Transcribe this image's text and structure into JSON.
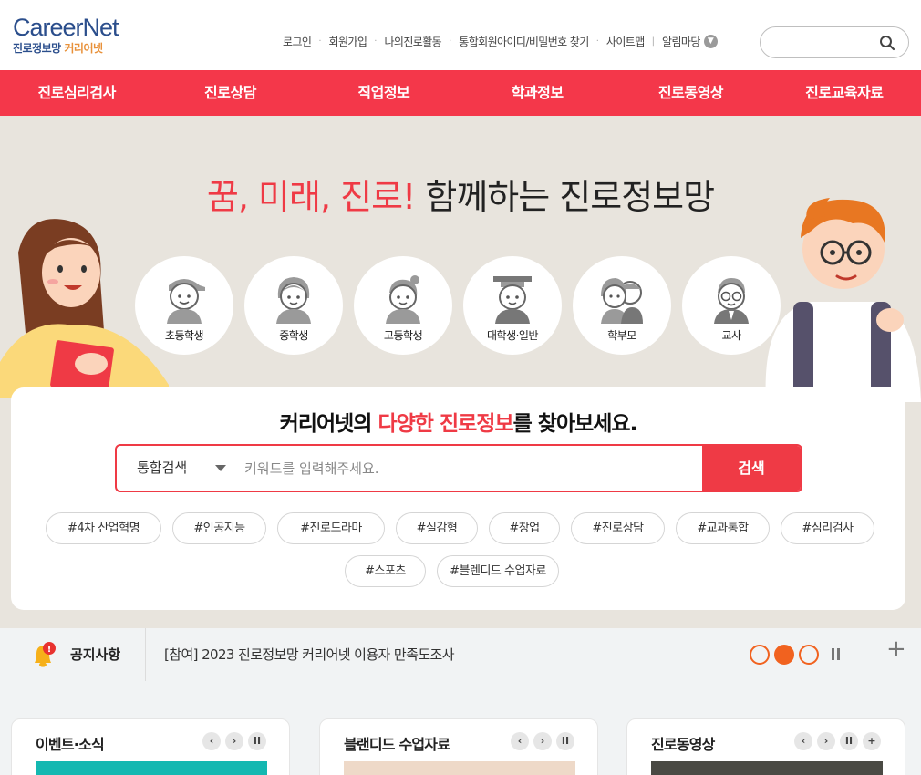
{
  "logo": {
    "main_a": "Career",
    "main_b": "Net",
    "sub_a": "진로정보망",
    "sub_b": "커리어넷"
  },
  "util": [
    "로그인",
    "회원가입",
    "나의진로활동",
    "통합회원아이디/비밀번호 찾기",
    "사이트맵",
    "알림마당"
  ],
  "nav": [
    "진로심리검사",
    "진로상담",
    "직업정보",
    "학과정보",
    "진로동영상",
    "진로교육자료"
  ],
  "hero": {
    "title_red": "꿈, 미래, 진로!",
    "title_rest": "함께하는 진로정보망",
    "targets": [
      "초등학생",
      "중학생",
      "고등학생",
      "대학생·일반",
      "학부모",
      "교사"
    ]
  },
  "search": {
    "title_a": "커리어넷의",
    "title_red": "다양한 진로정보",
    "title_b": "를 찾아보세요.",
    "select": "통합검색",
    "placeholder": "키워드를 입력해주세요.",
    "button": "검색",
    "tags_row1": [
      "#4차 산업혁명",
      "#인공지능",
      "#진로드라마",
      "#실감형",
      "#창업",
      "#진로상담",
      "#교과통합",
      "#심리검사"
    ],
    "tags_row2": [
      "#스포츠",
      "#블렌디드 수업자료"
    ]
  },
  "notice": {
    "label": "공지사항",
    "text": "[참여] 2023 진로정보망 커리어넷 이용자 만족도조사",
    "badge": "!",
    "plus": "+",
    "active_slide": 2,
    "slide_count": 3
  },
  "panels": [
    {
      "title": "이벤트·소식"
    },
    {
      "title": "블랜디드 수업자료"
    },
    {
      "title": "진로동영상"
    }
  ],
  "controls": {
    "prev": "‹",
    "next": "›",
    "pause": "II",
    "plus": "+"
  },
  "colors": {
    "brand_red": "#f4374a",
    "accent_orange": "#f1621f",
    "logo_blue": "#2b4e8c",
    "hero_bg": "#e8e4dd"
  }
}
